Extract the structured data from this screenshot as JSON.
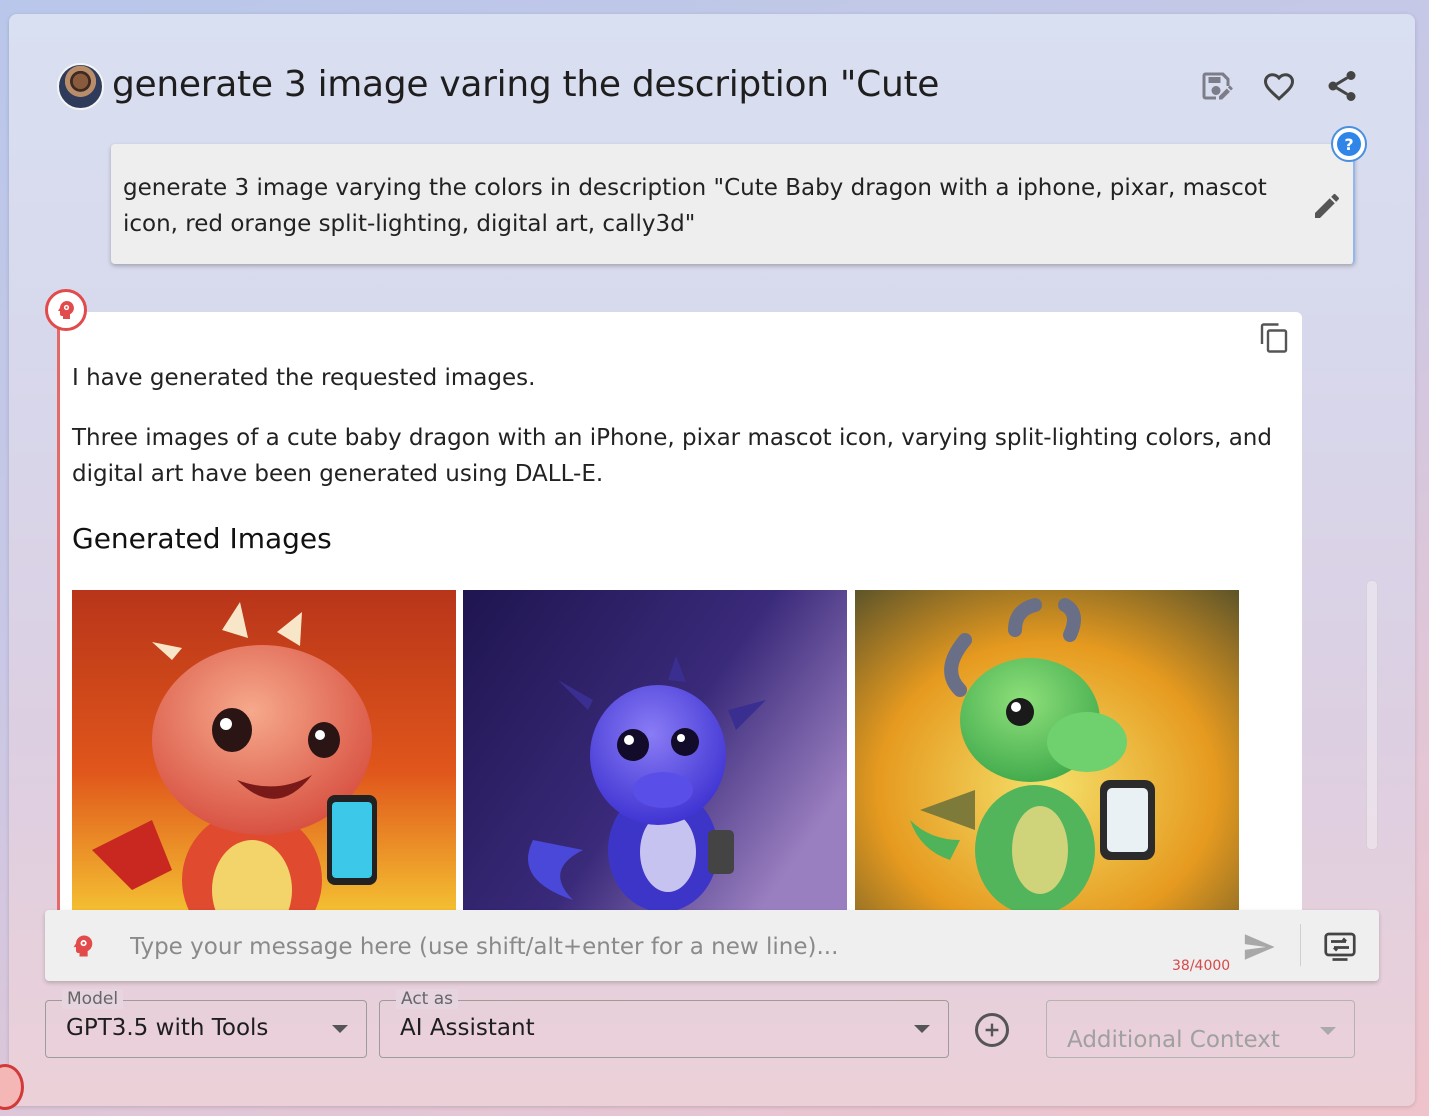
{
  "header": {
    "title": "generate 3 image varing the description \"Cute",
    "avatar_alt": "user avatar",
    "actions": [
      "save-icon",
      "heart-icon",
      "share-icon"
    ]
  },
  "user_message": {
    "text": "generate 3 image varying the colors in description \"Cute Baby dragon with a iphone, pixar, mascot icon, red orange split-lighting, digital art, cally3d\""
  },
  "ai_message": {
    "para1": "I have generated the requested images.",
    "para2": "Three images of a cute baby dragon with an iPhone, pixar mascot icon, varying split-lighting colors, and digital art have been generated using DALL-E.",
    "heading": "Generated Images",
    "images": [
      "red-orange dragon",
      "blue-purple dragon",
      "green dragon"
    ]
  },
  "composer": {
    "placeholder": "Type your message here (use shift/alt+enter for a new line)...",
    "counter": "38/4000"
  },
  "controls": {
    "model_label": "Model",
    "model_value": "GPT3.5 with Tools",
    "actas_label": "Act as",
    "actas_value": "AI Assistant",
    "additional_context": "Additional Context"
  },
  "colors": {
    "accent_red": "#e14b4b",
    "accent_blue": "#2f86e8"
  }
}
